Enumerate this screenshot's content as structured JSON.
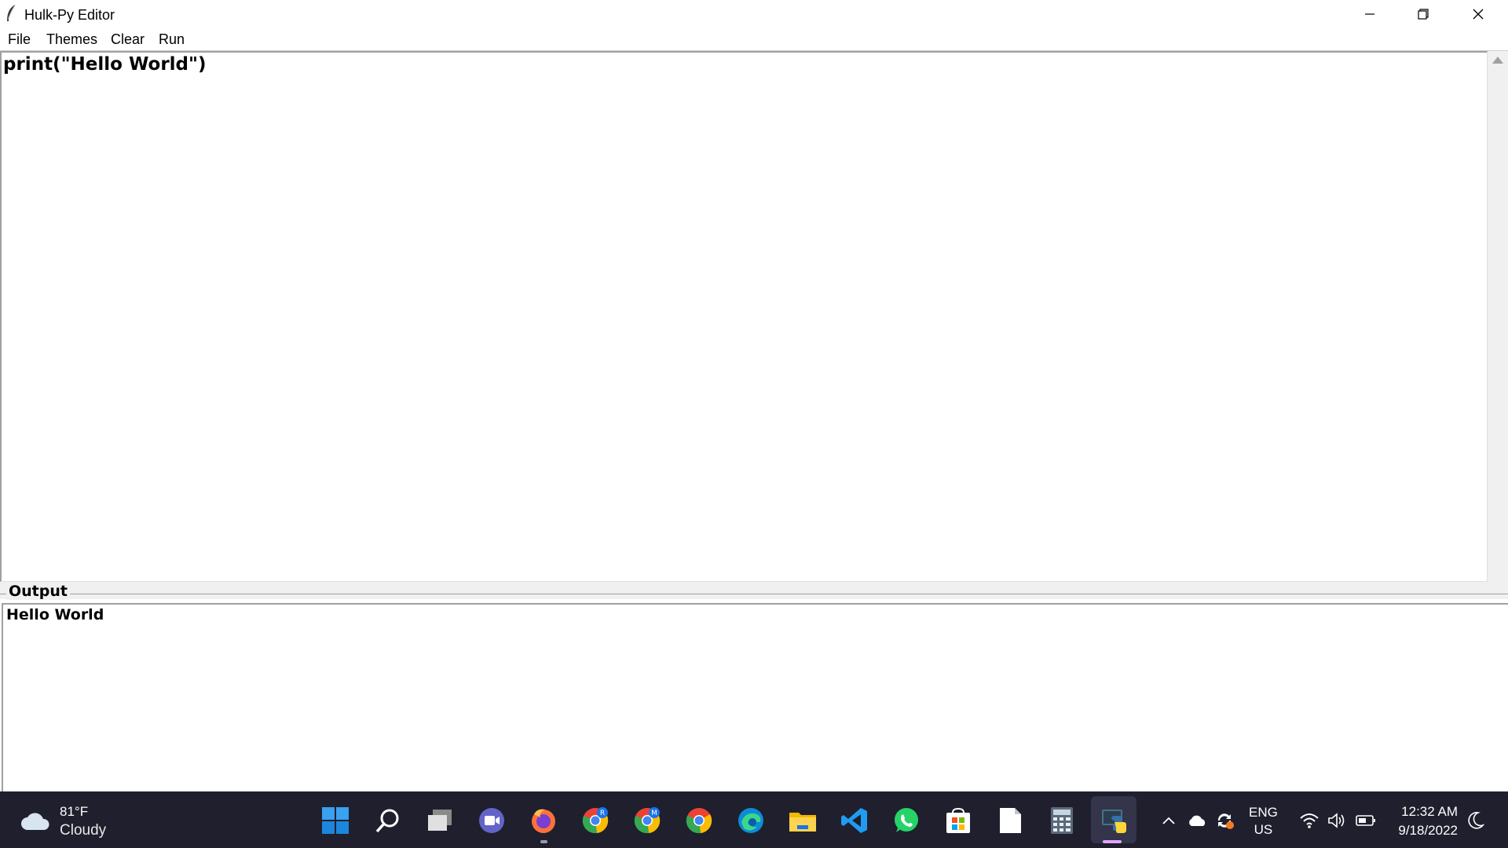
{
  "window": {
    "title": "Hulk-Py Editor"
  },
  "menu": {
    "items": [
      "File",
      "Themes",
      "Clear",
      "Run"
    ]
  },
  "editor": {
    "code": "print(\"Hello World\")"
  },
  "output": {
    "label": "Output",
    "text": "Hello World"
  },
  "taskbar": {
    "weather": {
      "temp": "81°F",
      "condition": "Cloudy",
      "icon": "cloud-icon"
    },
    "pinned_apps": [
      "windows-start-icon",
      "search-icon",
      "task-view-icon",
      "teams-chat-icon",
      "firefox-icon",
      "chrome-profile-r-icon",
      "chrome-profile-m-icon",
      "chrome-icon",
      "edge-icon",
      "file-explorer-icon",
      "vscode-icon",
      "whatsapp-icon",
      "microsoft-store-icon",
      "notepad-icon",
      "calculator-icon",
      "python-icon"
    ],
    "tray": {
      "language_line1": "ENG",
      "language_line2": "US"
    },
    "clock": {
      "time": "12:32 AM",
      "date": "9/18/2022"
    }
  },
  "colors": {
    "taskbar_bg": "#1f1f2e",
    "accent_indicator": "#e0a3ff"
  }
}
